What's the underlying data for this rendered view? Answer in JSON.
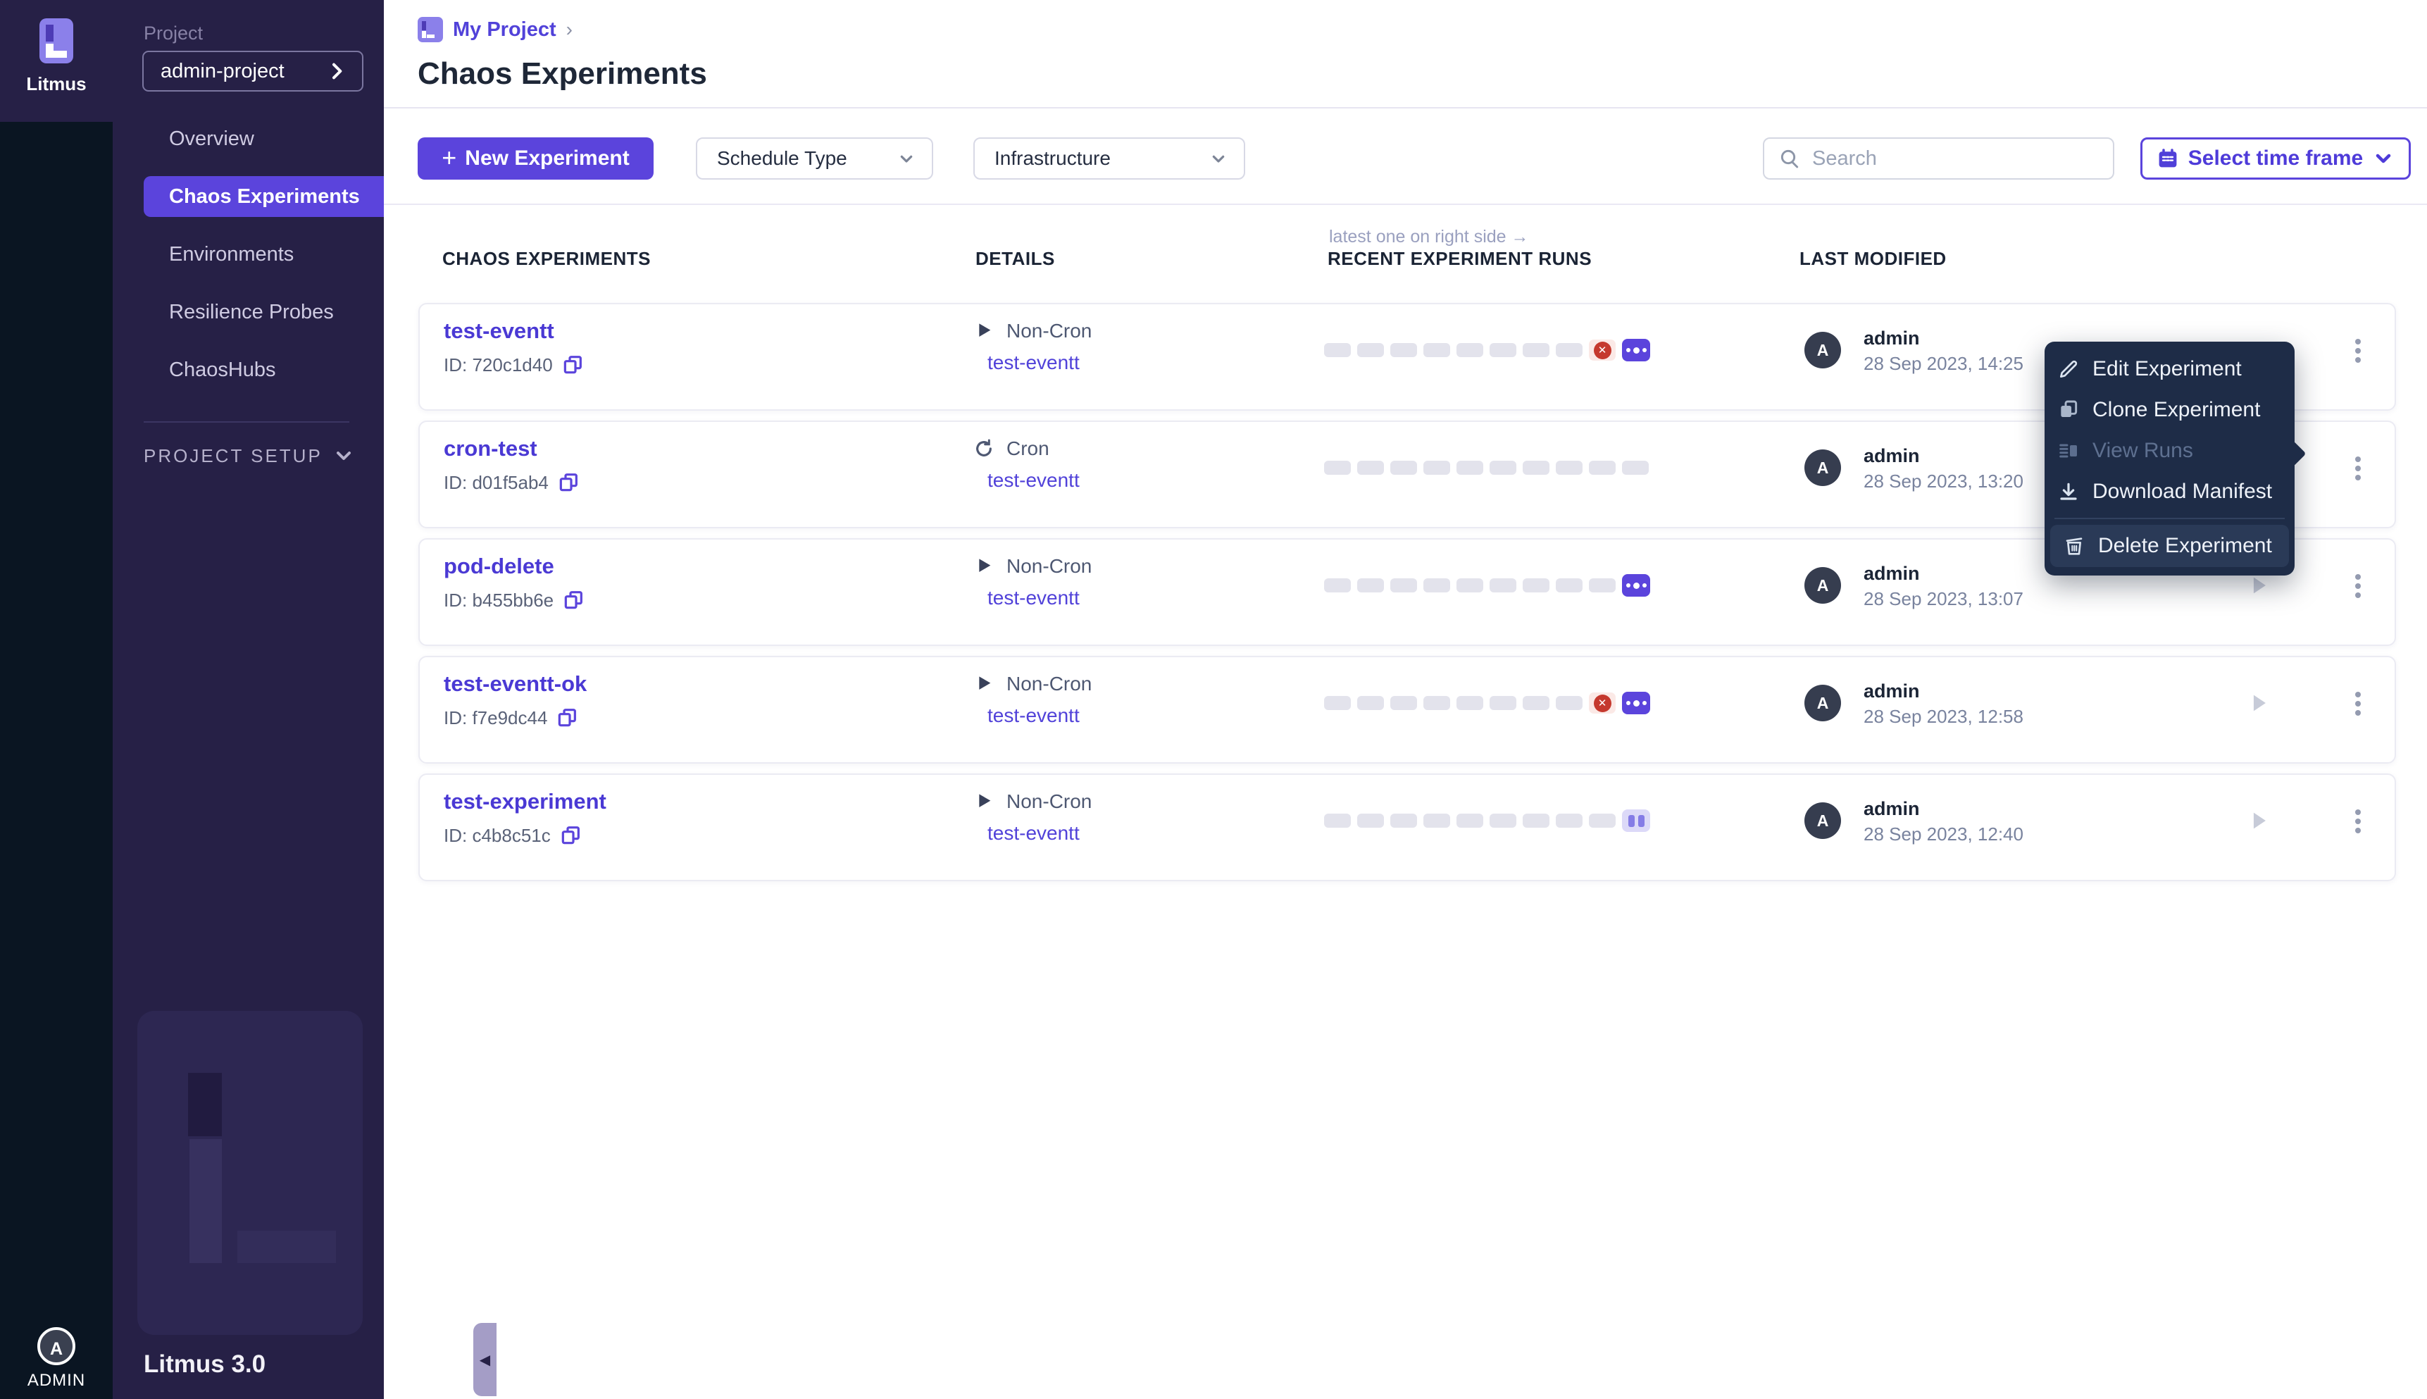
{
  "colors": {
    "accent": "#5b44dc",
    "link": "#5142d9",
    "failed_red": "#c5392e",
    "menu_bg": "#1e2c47",
    "sidebar_bg": "#262046",
    "rail_bg": "#0a1522"
  },
  "sidebar": {
    "brand": "Litmus",
    "project_label": "Project",
    "project_value": "admin-project",
    "nav": [
      {
        "label": "Overview"
      },
      {
        "label": "Chaos Experiments"
      },
      {
        "label": "Environments"
      },
      {
        "label": "Resilience Probes"
      },
      {
        "label": "ChaosHubs"
      }
    ],
    "setup_label": "PROJECT SETUP",
    "version": "Litmus 3.0",
    "admin_label": "ADMIN",
    "avatar_letter": "A",
    "collapse_arrow": "◀"
  },
  "header": {
    "breadcrumb": "My Project",
    "breadcrumb_chevron": "›",
    "title": "Chaos Experiments"
  },
  "toolbar": {
    "new_experiment": "New Experiment",
    "plus": "+",
    "schedule_type": "Schedule Type",
    "infrastructure": "Infrastructure",
    "search_placeholder": "Search",
    "time_frame": "Select time frame"
  },
  "table": {
    "col_experiments": "CHAOS EXPERIMENTS",
    "col_details": "DETAILS",
    "col_runs": "RECENT EXPERIMENT RUNS",
    "col_modified": "LAST MODIFIED",
    "runs_note": "latest one on right side →"
  },
  "rows": [
    {
      "name": "test-eventt",
      "id": "ID: 720c1d40",
      "type": "Non-Cron",
      "infra": "test-eventt",
      "avatar": "A",
      "modified_by": "admin",
      "modified_at": "28 Sep 2023, 14:25",
      "runs": [
        "slot",
        "slot",
        "slot",
        "slot",
        "slot",
        "slot",
        "slot",
        "slot",
        "failed",
        "running"
      ]
    },
    {
      "name": "cron-test",
      "id": "ID: d01f5ab4",
      "type": "Cron",
      "infra": "test-eventt",
      "avatar": "A",
      "modified_by": "admin",
      "modified_at": "28 Sep 2023, 13:20",
      "runs": [
        "slot",
        "slot",
        "slot",
        "slot",
        "slot",
        "slot",
        "slot",
        "slot",
        "slot",
        "slot"
      ]
    },
    {
      "name": "pod-delete",
      "id": "ID: b455bb6e",
      "type": "Non-Cron",
      "infra": "test-eventt",
      "avatar": "A",
      "modified_by": "admin",
      "modified_at": "28 Sep 2023, 13:07",
      "runs": [
        "slot",
        "slot",
        "slot",
        "slot",
        "slot",
        "slot",
        "slot",
        "slot",
        "slot",
        "running"
      ]
    },
    {
      "name": "test-eventt-ok",
      "id": "ID: f7e9dc44",
      "type": "Non-Cron",
      "infra": "test-eventt",
      "avatar": "A",
      "modified_by": "admin",
      "modified_at": "28 Sep 2023, 12:58",
      "runs": [
        "slot",
        "slot",
        "slot",
        "slot",
        "slot",
        "slot",
        "slot",
        "slot",
        "failed",
        "running"
      ]
    },
    {
      "name": "test-experiment",
      "id": "ID: c4b8c51c",
      "type": "Non-Cron",
      "infra": "test-eventt",
      "avatar": "A",
      "modified_by": "admin",
      "modified_at": "28 Sep 2023, 12:40",
      "runs": [
        "slot",
        "slot",
        "slot",
        "slot",
        "slot",
        "slot",
        "slot",
        "slot",
        "slot",
        "paused"
      ]
    }
  ],
  "menu": {
    "items": [
      {
        "label": "Edit Experiment"
      },
      {
        "label": "Clone Experiment"
      },
      {
        "label": "View Runs",
        "disabled": true
      },
      {
        "label": "Download Manifest"
      },
      {
        "label": "Delete Experiment",
        "highlighted": true
      }
    ]
  }
}
